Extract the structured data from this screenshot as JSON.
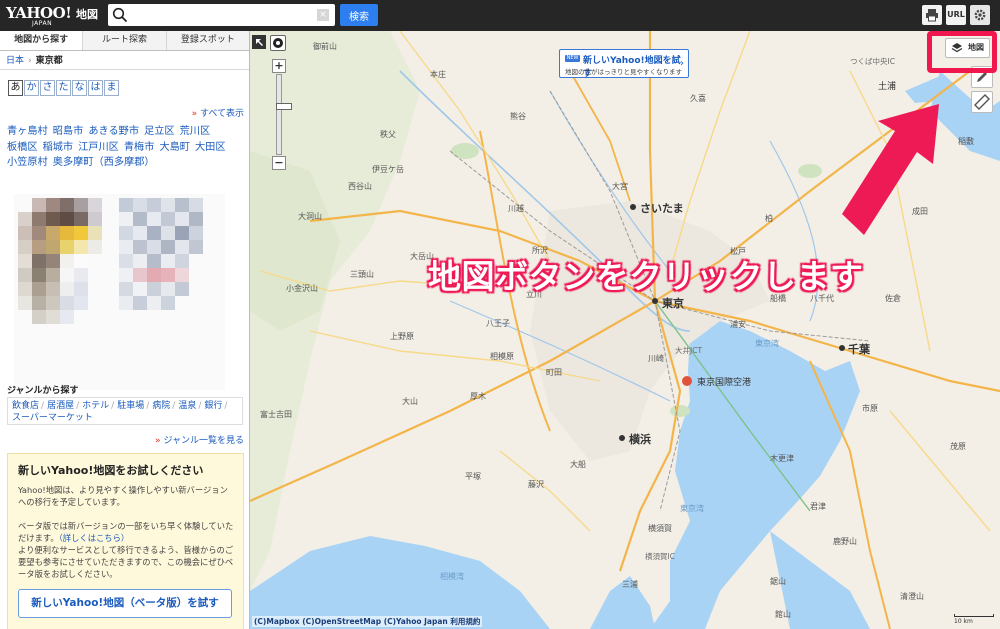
{
  "header": {
    "logo_text": "YAHOO!",
    "logo_sub": "JAPAN",
    "service": "地図",
    "search_value": "",
    "search_button": "検索",
    "clear_glyph": "×",
    "print_label": "",
    "url_label": "URL",
    "settings_label": ""
  },
  "sidebar": {
    "tabs": [
      {
        "label": "地図から探す"
      },
      {
        "label": "ルート探索"
      },
      {
        "label": "登録スポット"
      }
    ],
    "breadcrumb": {
      "root": "日本",
      "separator": "›",
      "current": "東京都"
    },
    "kana": [
      "あ",
      "か",
      "さ",
      "た",
      "な",
      "は",
      "ま"
    ],
    "show_all": "すべて表示",
    "link_marker": "»",
    "cities": [
      "青ヶ島村",
      "昭島市",
      "あきる野市",
      "足立区",
      "荒川区",
      "板橋区",
      "稲城市",
      "江戸川区",
      "青梅市",
      "大島町",
      "大田区",
      "小笠原村",
      "奥多摩町（西多摩郡）"
    ],
    "genre_title": "ジャンルから探す",
    "genres": [
      "飲食店",
      "居酒屋",
      "ホテル",
      "駐車場",
      "病院",
      "温泉",
      "銀行",
      "スーパーマーケット"
    ],
    "genre_separator": "/",
    "genre_list_link": "ジャンル一覧を見る",
    "beta": {
      "title": "新しいYahoo!地図をお試しください",
      "p1": "Yahoo!地図は、より見やすく操作しやすい新バージョンへの移行を予定しています。",
      "p2a": "ベータ版では新バージョンの一部をいち早く体験していただけます。",
      "p2link": "（詳しくはこちら）",
      "p2b": "より便利なサービスとして移行できるよう、皆様からのご要望も参考にさせていただきますので、この機会にぜひベータ版をお試しください。",
      "button": "新しいYahoo!地図（ベータ版）を試す"
    }
  },
  "map": {
    "banner": {
      "badge": "NEW",
      "title": "新しいYahoo!地図を試す",
      "subtitle": "地図の色がはっきりと見やすくなります",
      "arrow": "›"
    },
    "zoom_in": "+",
    "zoom_out": "−",
    "layer_button": "地図",
    "annotation": "地図ボタンをクリックします",
    "attribution": "(C)Mapbox (C)OpenStreetMap (C)Yahoo Japan 利用規約",
    "scale_label": "10 km",
    "places": [
      {
        "name": "東京",
        "cls": "big"
      },
      {
        "name": "さいたま",
        "cls": "big"
      },
      {
        "name": "千葉",
        "cls": "big"
      },
      {
        "name": "横浜",
        "cls": "big"
      },
      {
        "name": "東京湾",
        "cls": "water"
      },
      {
        "name": "相模湾",
        "cls": "water"
      },
      {
        "name": "東京国際空港",
        "cls": "mid"
      },
      {
        "name": "秩父",
        "cls": ""
      },
      {
        "name": "伊豆ケ岳",
        "cls": ""
      },
      {
        "name": "西谷山",
        "cls": ""
      },
      {
        "name": "大洞山",
        "cls": ""
      },
      {
        "name": "大岳山",
        "cls": ""
      },
      {
        "name": "三頭山",
        "cls": ""
      },
      {
        "name": "小金沢山",
        "cls": ""
      },
      {
        "name": "上野原",
        "cls": ""
      },
      {
        "name": "相模原",
        "cls": ""
      },
      {
        "name": "厚木",
        "cls": ""
      },
      {
        "name": "平塚",
        "cls": ""
      },
      {
        "name": "大山",
        "cls": ""
      },
      {
        "name": "富士吉田",
        "cls": ""
      },
      {
        "name": "藤沢",
        "cls": ""
      },
      {
        "name": "大船",
        "cls": ""
      },
      {
        "name": "土浦",
        "cls": "mid"
      },
      {
        "name": "つくば中央IC",
        "cls": "ic"
      },
      {
        "name": "稲敷",
        "cls": ""
      },
      {
        "name": "御前山",
        "cls": ""
      },
      {
        "name": "大宮",
        "cls": ""
      },
      {
        "name": "川越",
        "cls": ""
      },
      {
        "name": "所沢",
        "cls": ""
      },
      {
        "name": "立川",
        "cls": ""
      },
      {
        "name": "八王子",
        "cls": ""
      },
      {
        "name": "町田",
        "cls": ""
      },
      {
        "name": "川崎",
        "cls": ""
      },
      {
        "name": "船橋",
        "cls": ""
      },
      {
        "name": "市原",
        "cls": ""
      },
      {
        "name": "木更津",
        "cls": ""
      },
      {
        "name": "君津",
        "cls": ""
      },
      {
        "name": "東京湾",
        "cls": "water"
      },
      {
        "name": "横須賀",
        "cls": ""
      },
      {
        "name": "三浦",
        "cls": ""
      },
      {
        "name": "鋸山",
        "cls": ""
      },
      {
        "name": "館山",
        "cls": ""
      },
      {
        "name": "鹿野山",
        "cls": ""
      },
      {
        "name": "清澄山",
        "cls": ""
      },
      {
        "name": "大井JCT",
        "cls": "ic"
      },
      {
        "name": "浦安",
        "cls": ""
      },
      {
        "name": "松戸",
        "cls": ""
      },
      {
        "name": "柏",
        "cls": ""
      },
      {
        "name": "成田",
        "cls": ""
      },
      {
        "name": "佐倉",
        "cls": ""
      },
      {
        "name": "八千代",
        "cls": ""
      },
      {
        "name": "茂原",
        "cls": ""
      },
      {
        "name": "久喜",
        "cls": ""
      },
      {
        "name": "熊谷",
        "cls": ""
      },
      {
        "name": "本庄",
        "cls": ""
      },
      {
        "name": "横須賀IC",
        "cls": "ic"
      }
    ]
  }
}
